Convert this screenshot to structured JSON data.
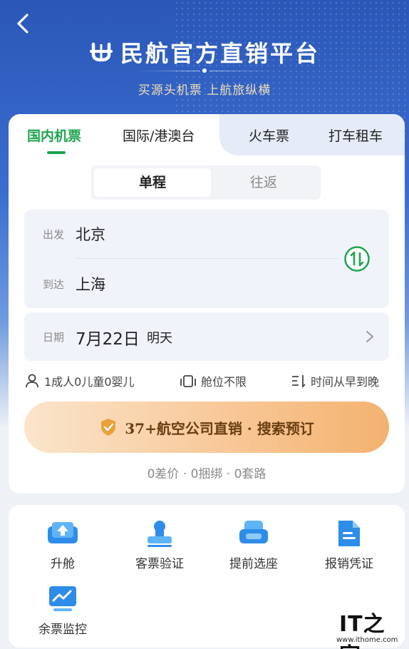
{
  "header": {
    "back_icon": "chevron-left-icon",
    "brand_title": "民航官方直销平台",
    "brand_subtitle": "买源头机票 上航旅纵横"
  },
  "tabs": [
    {
      "label": "国内机票",
      "active": true
    },
    {
      "label": "国际/港澳台",
      "active": false
    },
    {
      "label": "火车票",
      "active": false
    },
    {
      "label": "打车租车",
      "active": false
    }
  ],
  "trip_type": {
    "one_way": "单程",
    "round_trip": "往返",
    "selected": "单程"
  },
  "route": {
    "depart_label": "出发",
    "depart_city": "北京",
    "arrive_label": "到达",
    "arrive_city": "上海",
    "swap_icon": "swap-icon"
  },
  "date": {
    "label": "日期",
    "value": "7月22日",
    "day": "明天"
  },
  "options": {
    "passengers": "1成人0儿童0婴儿",
    "cabin": "舱位不限",
    "sort": "时间从早到晚"
  },
  "search": {
    "label": "37+航空公司直销 · 搜索预订",
    "icon": "shield-check-icon"
  },
  "guarantee": "0差价 · 0捆绑 · 0套路",
  "services": [
    {
      "label": "升舱",
      "icon": "upgrade-seat-icon"
    },
    {
      "label": "客票验证",
      "icon": "stamp-icon"
    },
    {
      "label": "提前选座",
      "icon": "seat-icon"
    },
    {
      "label": "报销凭证",
      "icon": "document-icon"
    },
    {
      "label": "余票监控",
      "icon": "monitor-chart-icon"
    }
  ],
  "watermark": {
    "logo": "IT之家",
    "url": "www.ithome.com"
  },
  "colors": {
    "accent_green": "#1ea54f",
    "brand_blue": "#2a57b8",
    "search_gold": "#f4b270"
  }
}
